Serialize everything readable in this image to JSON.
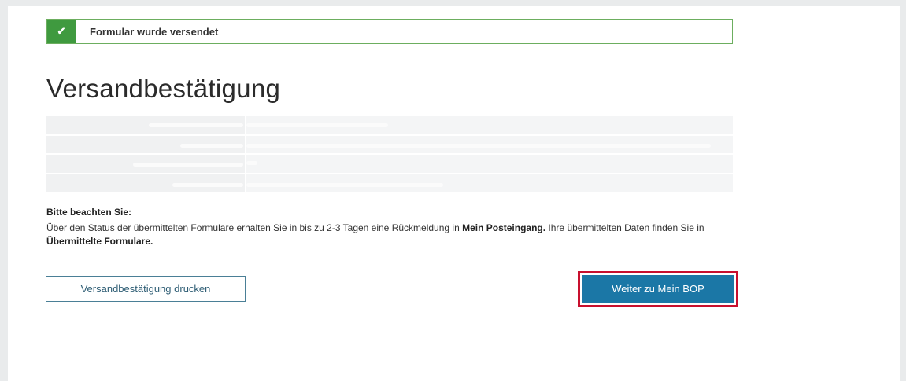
{
  "alert": {
    "icon": "check-icon",
    "text": "Formular wurde versendet"
  },
  "page": {
    "title": "Versandbestätigung"
  },
  "notice": {
    "title": "Bitte beachten Sie:",
    "text_part1": "Über den Status der übermittelten Formulare erhalten Sie in bis zu 2-3 Tagen eine Rückmeldung in ",
    "link1": "Mein Posteingang.",
    "text_part2": " Ihre übermittelten Daten finden Sie in ",
    "link2": "Übermittelte Formulare."
  },
  "buttons": {
    "print_label": "Versandbestätigung drucken",
    "next_label": "Weiter zu Mein BOP"
  },
  "colors": {
    "success": "#3f9a3f",
    "primary": "#1b77a6",
    "highlight": "#c8102e"
  }
}
